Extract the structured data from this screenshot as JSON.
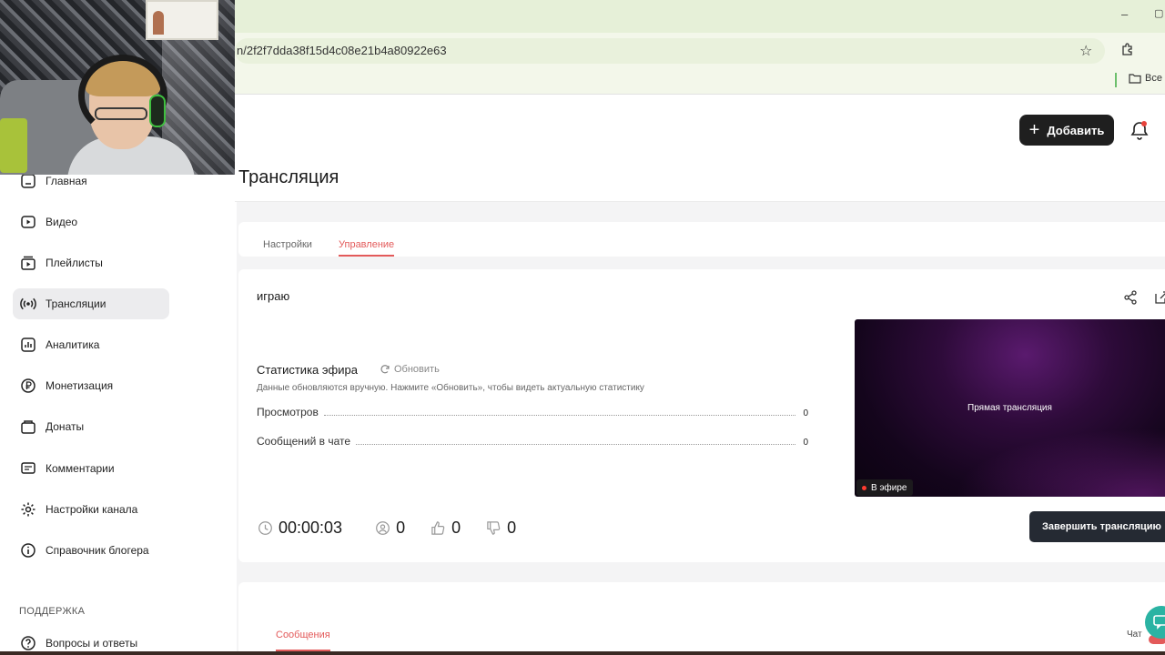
{
  "browser": {
    "url_fragment": "n/2f2f7dda38f15d4c08e21b4a80922e63",
    "bookmarks_folder": "Все"
  },
  "header": {
    "add_label": "Добавить",
    "page_title": "Трансляция"
  },
  "sidebar": {
    "items": [
      {
        "label": "Главная",
        "icon": "home-icon"
      },
      {
        "label": "Видео",
        "icon": "video-icon"
      },
      {
        "label": "Плейлисты",
        "icon": "playlist-icon"
      },
      {
        "label": "Трансляции",
        "icon": "broadcast-icon",
        "active": true
      },
      {
        "label": "Аналитика",
        "icon": "analytics-icon"
      },
      {
        "label": "Монетизация",
        "icon": "ruble-icon"
      },
      {
        "label": "Донаты",
        "icon": "donate-icon"
      },
      {
        "label": "Комментарии",
        "icon": "comments-icon"
      },
      {
        "label": "Настройки канала",
        "icon": "gear-icon"
      },
      {
        "label": "Справочник блогера",
        "icon": "info-icon"
      }
    ],
    "support_heading": "ПОДДЕРЖКА",
    "support_items": [
      {
        "label": "Вопросы и ответы",
        "icon": "help-icon"
      }
    ]
  },
  "tabs": {
    "settings": "Настройки",
    "management": "Управление",
    "active": "management"
  },
  "stream": {
    "name": "играю",
    "stats_title": "Статистика эфира",
    "refresh_label": "Обновить",
    "stats_note": "Данные обновляются вручную. Нажмите «Обновить», чтобы видеть актуальную статистику",
    "views_label": "Просмотров",
    "views_value": "0",
    "chat_messages_label": "Сообщений в чате",
    "chat_messages_value": "0",
    "timer": "00:00:03",
    "viewers": "0",
    "likes": "0",
    "dislikes": "0",
    "preview_label": "Прямая трансляция",
    "live_badge": "В эфире",
    "end_button": "Завершить трансляцию"
  },
  "lower": {
    "messages_tab": "Сообщения",
    "chat_tab": "Чат"
  },
  "colors": {
    "accent": "#e35a5a",
    "dark_button": "#1f1f1f",
    "end_button": "#252a33",
    "live_dot": "#ff3b30",
    "browser_chrome": "#e6f0d8"
  }
}
